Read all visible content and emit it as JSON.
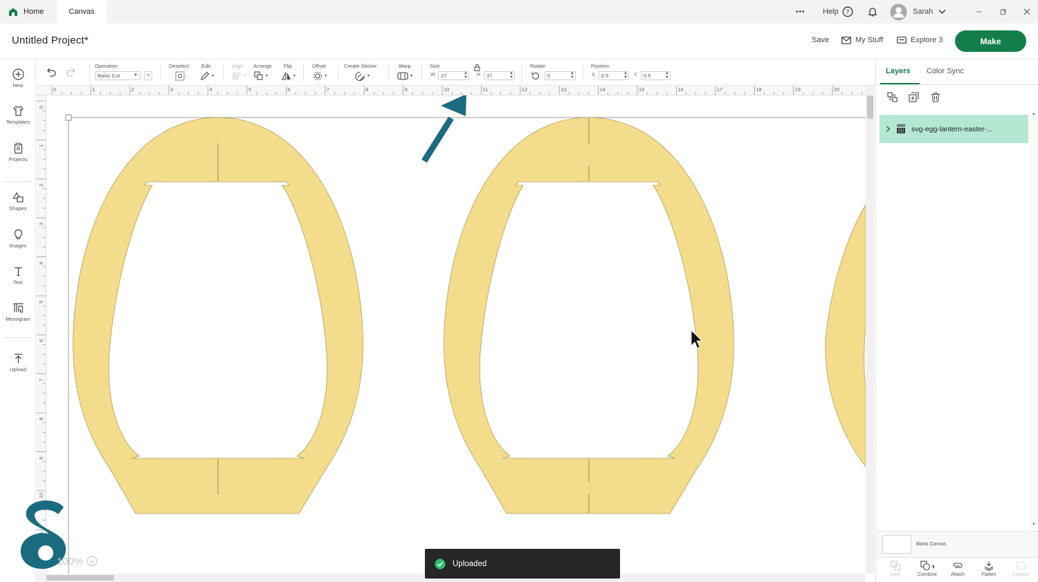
{
  "tabs": {
    "home": "Home",
    "canvas": "Canvas"
  },
  "topbar": {
    "more": "•••",
    "help": "Help",
    "user": "Sarah"
  },
  "header": {
    "title": "Untitled Project*",
    "save": "Save",
    "my_stuff": "My Stuff",
    "machine": "Explore 3",
    "make": "Make"
  },
  "sidebar": [
    {
      "label": "New",
      "icon": "plus-circle-icon"
    },
    {
      "label": "Templates",
      "icon": "shirt-icon"
    },
    {
      "label": "Projects",
      "icon": "clipboard-icon"
    },
    {
      "label": "Shapes",
      "icon": "shapes-icon"
    },
    {
      "label": "Images",
      "icon": "lightbulb-icon"
    },
    {
      "label": "Text",
      "icon": "text-icon"
    },
    {
      "label": "Monogram",
      "icon": "monogram-icon"
    },
    {
      "label": "Upload",
      "icon": "upload-icon"
    }
  ],
  "toolbar": {
    "operation_label": "Operation",
    "operation_value": "Basic Cut",
    "operation_help": "?",
    "deselect": "Deselect",
    "edit": "Edit",
    "align": "Align",
    "arrange": "Arrange",
    "flip": "Flip",
    "offset": "Offset",
    "create_sticker": "Create Sticker",
    "warp": "Warp",
    "size": "Size",
    "w_label": "W",
    "w_value": "27",
    "h_label": "H",
    "h_value": "37",
    "rotate": "Rotate",
    "rotate_value": "0",
    "position": "Position",
    "x_label": "X",
    "x_value": "0.5",
    "y_label": "Y",
    "y_value": "0.5"
  },
  "rulers": {
    "top": [
      "0",
      "1",
      "2",
      "3",
      "4",
      "5",
      "6",
      "7",
      "8",
      "9",
      "10",
      "11",
      "12",
      "13",
      "14",
      "15",
      "16",
      "17",
      "18",
      "19",
      "20"
    ],
    "left": [
      "0",
      "1",
      "2",
      "3",
      "4",
      "5",
      "6",
      "7",
      "8",
      "9",
      "10",
      "11"
    ]
  },
  "zoom": {
    "value": "100%",
    "plus": "+"
  },
  "toast": {
    "message": "Uploaded"
  },
  "panel": {
    "tab_layers": "Layers",
    "tab_color_sync": "Color Sync",
    "layer_name": "svg-egg-lantern-easter-...",
    "blank_canvas": "Blank Canvas"
  },
  "bottom_tools": [
    {
      "label": "Slice",
      "enabled": false
    },
    {
      "label": "Combine",
      "enabled": true
    },
    {
      "label": "Attach",
      "enabled": true
    },
    {
      "label": "Flatten",
      "enabled": true
    },
    {
      "label": "Contour",
      "enabled": false
    }
  ],
  "colors": {
    "accent": "#137e4c",
    "shape_fill": "#f3dd8c",
    "layer_selected": "#b5e8d3",
    "arrow": "#1b6b80",
    "toast": "#262626"
  }
}
